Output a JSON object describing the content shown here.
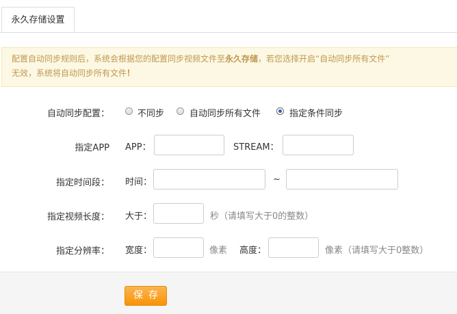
{
  "tabs": [
    {
      "label": "永久存储设置"
    }
  ],
  "notice": {
    "part1": "配置自动同步规则后，系统会根据您的配置同步视频文件至",
    "bold1": "永久存储",
    "part2": "，若您选择开启“自动同步所有文件”",
    "line2": "无效，系统将自动同步所有文件",
    "bold2": "！"
  },
  "form": {
    "sync_mode": {
      "label": "自动同步配置：",
      "options": [
        "不同步",
        "自动同步所有文件",
        "指定条件同步"
      ],
      "selected": "指定条件同步"
    },
    "app": {
      "label": "指定APP",
      "app_prefix": "APP：",
      "app_value": "",
      "stream_prefix": "STREAM：",
      "stream_value": ""
    },
    "period": {
      "label": "指定时间段：",
      "prefix": "时间：",
      "start": "",
      "separator": "~",
      "end": ""
    },
    "duration": {
      "label": "指定视频长度：",
      "prefix": "大于：",
      "value": "",
      "hint": "秒（请填写大于0的整数）"
    },
    "resolution": {
      "label": "指定分辨率：",
      "width_prefix": "宽度：",
      "width_value": "",
      "width_unit": "像素",
      "height_prefix": "高度：",
      "height_value": "",
      "height_hint": "像素（请填写大于0整数）"
    }
  },
  "actions": {
    "save_label": "保存"
  }
}
